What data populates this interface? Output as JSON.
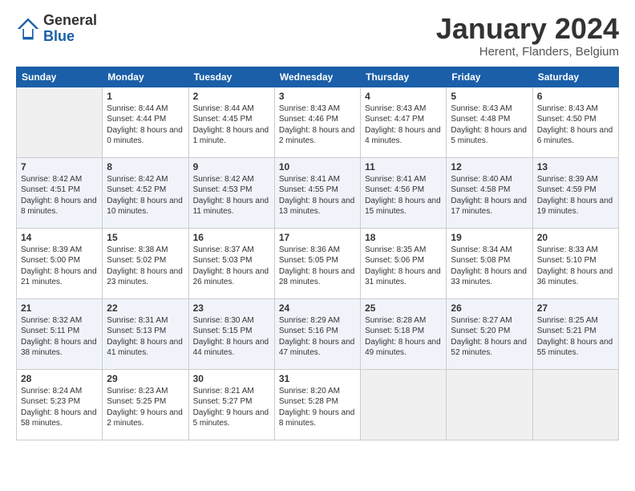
{
  "logo": {
    "general": "General",
    "blue": "Blue"
  },
  "title": "January 2024",
  "subtitle": "Herent, Flanders, Belgium",
  "weekdays": [
    "Sunday",
    "Monday",
    "Tuesday",
    "Wednesday",
    "Thursday",
    "Friday",
    "Saturday"
  ],
  "weeks": [
    [
      {
        "day": "",
        "sunrise": "",
        "sunset": "",
        "daylight": "",
        "empty": true
      },
      {
        "day": "1",
        "sunrise": "Sunrise: 8:44 AM",
        "sunset": "Sunset: 4:44 PM",
        "daylight": "Daylight: 8 hours and 0 minutes."
      },
      {
        "day": "2",
        "sunrise": "Sunrise: 8:44 AM",
        "sunset": "Sunset: 4:45 PM",
        "daylight": "Daylight: 8 hours and 1 minute."
      },
      {
        "day": "3",
        "sunrise": "Sunrise: 8:43 AM",
        "sunset": "Sunset: 4:46 PM",
        "daylight": "Daylight: 8 hours and 2 minutes."
      },
      {
        "day": "4",
        "sunrise": "Sunrise: 8:43 AM",
        "sunset": "Sunset: 4:47 PM",
        "daylight": "Daylight: 8 hours and 4 minutes."
      },
      {
        "day": "5",
        "sunrise": "Sunrise: 8:43 AM",
        "sunset": "Sunset: 4:48 PM",
        "daylight": "Daylight: 8 hours and 5 minutes."
      },
      {
        "day": "6",
        "sunrise": "Sunrise: 8:43 AM",
        "sunset": "Sunset: 4:50 PM",
        "daylight": "Daylight: 8 hours and 6 minutes."
      }
    ],
    [
      {
        "day": "7",
        "sunrise": "Sunrise: 8:42 AM",
        "sunset": "Sunset: 4:51 PM",
        "daylight": "Daylight: 8 hours and 8 minutes."
      },
      {
        "day": "8",
        "sunrise": "Sunrise: 8:42 AM",
        "sunset": "Sunset: 4:52 PM",
        "daylight": "Daylight: 8 hours and 10 minutes."
      },
      {
        "day": "9",
        "sunrise": "Sunrise: 8:42 AM",
        "sunset": "Sunset: 4:53 PM",
        "daylight": "Daylight: 8 hours and 11 minutes."
      },
      {
        "day": "10",
        "sunrise": "Sunrise: 8:41 AM",
        "sunset": "Sunset: 4:55 PM",
        "daylight": "Daylight: 8 hours and 13 minutes."
      },
      {
        "day": "11",
        "sunrise": "Sunrise: 8:41 AM",
        "sunset": "Sunset: 4:56 PM",
        "daylight": "Daylight: 8 hours and 15 minutes."
      },
      {
        "day": "12",
        "sunrise": "Sunrise: 8:40 AM",
        "sunset": "Sunset: 4:58 PM",
        "daylight": "Daylight: 8 hours and 17 minutes."
      },
      {
        "day": "13",
        "sunrise": "Sunrise: 8:39 AM",
        "sunset": "Sunset: 4:59 PM",
        "daylight": "Daylight: 8 hours and 19 minutes."
      }
    ],
    [
      {
        "day": "14",
        "sunrise": "Sunrise: 8:39 AM",
        "sunset": "Sunset: 5:00 PM",
        "daylight": "Daylight: 8 hours and 21 minutes."
      },
      {
        "day": "15",
        "sunrise": "Sunrise: 8:38 AM",
        "sunset": "Sunset: 5:02 PM",
        "daylight": "Daylight: 8 hours and 23 minutes."
      },
      {
        "day": "16",
        "sunrise": "Sunrise: 8:37 AM",
        "sunset": "Sunset: 5:03 PM",
        "daylight": "Daylight: 8 hours and 26 minutes."
      },
      {
        "day": "17",
        "sunrise": "Sunrise: 8:36 AM",
        "sunset": "Sunset: 5:05 PM",
        "daylight": "Daylight: 8 hours and 28 minutes."
      },
      {
        "day": "18",
        "sunrise": "Sunrise: 8:35 AM",
        "sunset": "Sunset: 5:06 PM",
        "daylight": "Daylight: 8 hours and 31 minutes."
      },
      {
        "day": "19",
        "sunrise": "Sunrise: 8:34 AM",
        "sunset": "Sunset: 5:08 PM",
        "daylight": "Daylight: 8 hours and 33 minutes."
      },
      {
        "day": "20",
        "sunrise": "Sunrise: 8:33 AM",
        "sunset": "Sunset: 5:10 PM",
        "daylight": "Daylight: 8 hours and 36 minutes."
      }
    ],
    [
      {
        "day": "21",
        "sunrise": "Sunrise: 8:32 AM",
        "sunset": "Sunset: 5:11 PM",
        "daylight": "Daylight: 8 hours and 38 minutes."
      },
      {
        "day": "22",
        "sunrise": "Sunrise: 8:31 AM",
        "sunset": "Sunset: 5:13 PM",
        "daylight": "Daylight: 8 hours and 41 minutes."
      },
      {
        "day": "23",
        "sunrise": "Sunrise: 8:30 AM",
        "sunset": "Sunset: 5:15 PM",
        "daylight": "Daylight: 8 hours and 44 minutes."
      },
      {
        "day": "24",
        "sunrise": "Sunrise: 8:29 AM",
        "sunset": "Sunset: 5:16 PM",
        "daylight": "Daylight: 8 hours and 47 minutes."
      },
      {
        "day": "25",
        "sunrise": "Sunrise: 8:28 AM",
        "sunset": "Sunset: 5:18 PM",
        "daylight": "Daylight: 8 hours and 49 minutes."
      },
      {
        "day": "26",
        "sunrise": "Sunrise: 8:27 AM",
        "sunset": "Sunset: 5:20 PM",
        "daylight": "Daylight: 8 hours and 52 minutes."
      },
      {
        "day": "27",
        "sunrise": "Sunrise: 8:25 AM",
        "sunset": "Sunset: 5:21 PM",
        "daylight": "Daylight: 8 hours and 55 minutes."
      }
    ],
    [
      {
        "day": "28",
        "sunrise": "Sunrise: 8:24 AM",
        "sunset": "Sunset: 5:23 PM",
        "daylight": "Daylight: 8 hours and 58 minutes."
      },
      {
        "day": "29",
        "sunrise": "Sunrise: 8:23 AM",
        "sunset": "Sunset: 5:25 PM",
        "daylight": "Daylight: 9 hours and 2 minutes."
      },
      {
        "day": "30",
        "sunrise": "Sunrise: 8:21 AM",
        "sunset": "Sunset: 5:27 PM",
        "daylight": "Daylight: 9 hours and 5 minutes."
      },
      {
        "day": "31",
        "sunrise": "Sunrise: 8:20 AM",
        "sunset": "Sunset: 5:28 PM",
        "daylight": "Daylight: 9 hours and 8 minutes."
      },
      {
        "day": "",
        "sunrise": "",
        "sunset": "",
        "daylight": "",
        "empty": true
      },
      {
        "day": "",
        "sunrise": "",
        "sunset": "",
        "daylight": "",
        "empty": true
      },
      {
        "day": "",
        "sunrise": "",
        "sunset": "",
        "daylight": "",
        "empty": true
      }
    ]
  ]
}
